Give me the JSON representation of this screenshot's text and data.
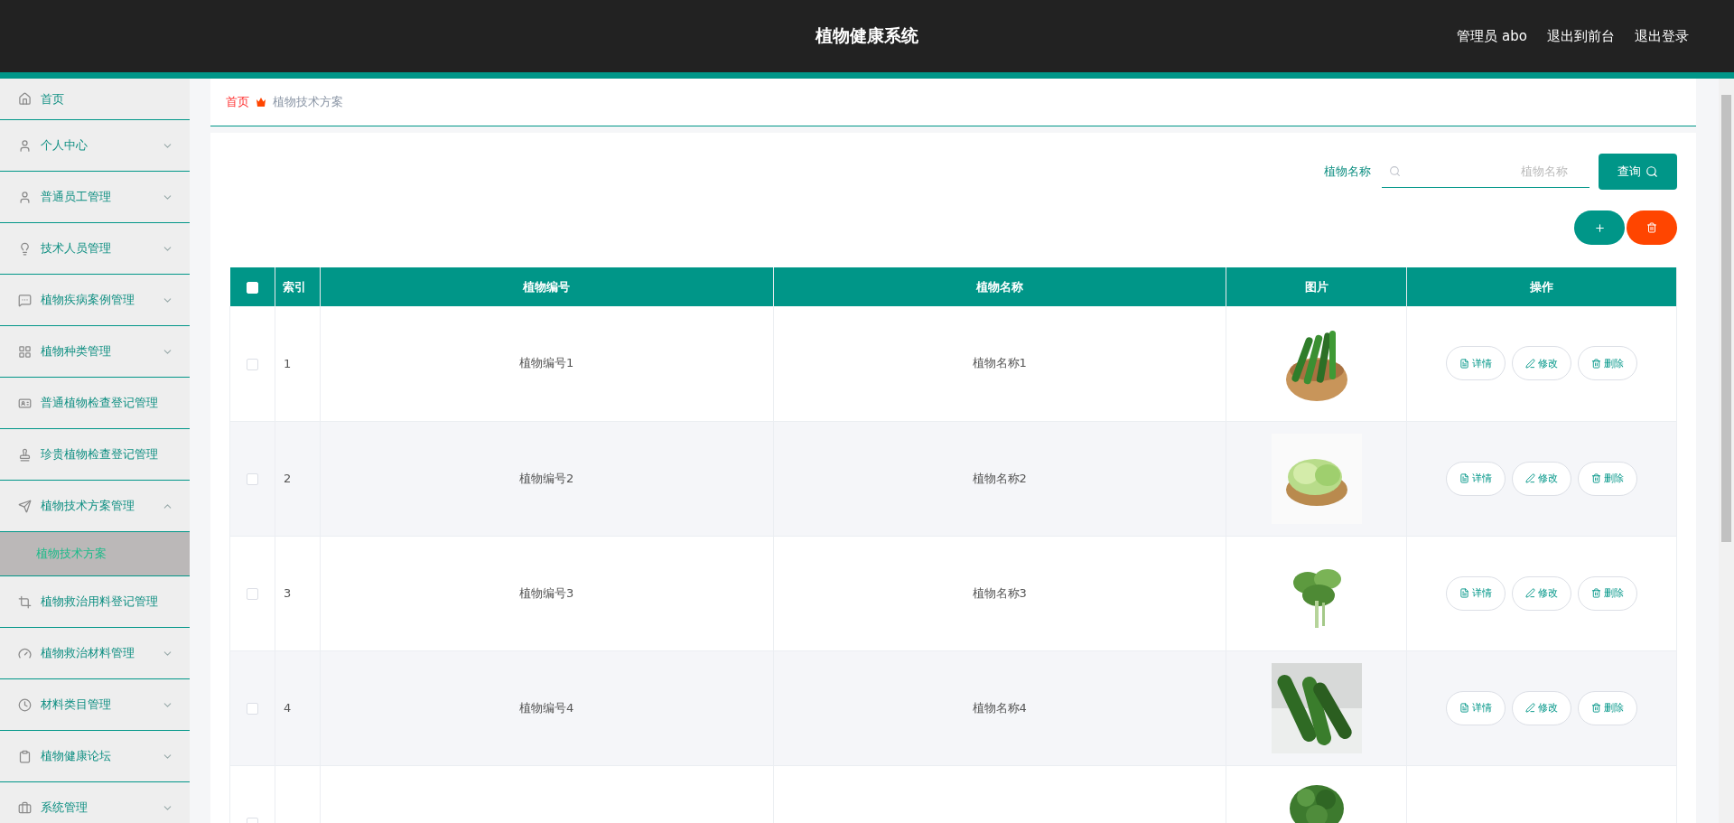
{
  "header": {
    "title": "植物健康系统",
    "links": [
      "管理员 abo",
      "退出到前台",
      "退出登录"
    ]
  },
  "sidebar": {
    "items": [
      {
        "label": "首页",
        "kind": "link"
      },
      {
        "label": "个人中心",
        "kind": "menu",
        "expanded": false
      },
      {
        "label": "普通员工管理",
        "kind": "menu",
        "expanded": false
      },
      {
        "label": "技术人员管理",
        "kind": "menu",
        "expanded": false
      },
      {
        "label": "植物疾病案例管理",
        "kind": "menu",
        "expanded": false
      },
      {
        "label": "植物种类管理",
        "kind": "menu",
        "expanded": false
      },
      {
        "label": "普通植物检查登记管理",
        "kind": "link"
      },
      {
        "label": "珍贵植物检查登记管理",
        "kind": "link"
      },
      {
        "label": "植物技术方案管理",
        "kind": "menu",
        "expanded": true,
        "children": [
          {
            "label": "植物技术方案",
            "selected": true
          }
        ]
      },
      {
        "label": "植物救治用料登记管理",
        "kind": "link"
      },
      {
        "label": "植物救治材料管理",
        "kind": "menu",
        "expanded": false
      },
      {
        "label": "材料类目管理",
        "kind": "menu",
        "expanded": false
      },
      {
        "label": "植物健康论坛",
        "kind": "menu",
        "expanded": false
      },
      {
        "label": "系统管理",
        "kind": "menu",
        "expanded": false
      }
    ]
  },
  "breadcrumb": [
    "首页",
    "植物技术方案"
  ],
  "search": {
    "label": "植物名称",
    "placeholder": "植物名称",
    "button": "查询"
  },
  "table": {
    "all_checked": false,
    "columns": [
      "索引",
      "植物编号",
      "植物名称",
      "图片",
      "操作"
    ],
    "rows": [
      {
        "checked": false,
        "index": "1",
        "code": "植物编号1",
        "name": "植物名称1",
        "actions": [
          "详情",
          "修改",
          "删除"
        ]
      },
      {
        "checked": false,
        "index": "2",
        "code": "植物编号2",
        "name": "植物名称2",
        "actions": [
          "详情",
          "修改",
          "删除"
        ]
      },
      {
        "checked": false,
        "index": "3",
        "code": "植物编号3",
        "name": "植物名称3",
        "actions": [
          "详情",
          "修改",
          "删除"
        ]
      },
      {
        "checked": false,
        "index": "4",
        "code": "植物编号4",
        "name": "植物名称4",
        "actions": [
          "详情",
          "修改",
          "删除"
        ]
      },
      {
        "checked": false
      }
    ]
  }
}
